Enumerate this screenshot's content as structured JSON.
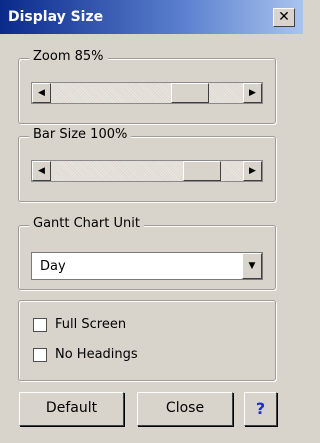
{
  "window": {
    "title": "Display Size",
    "close_glyph": "✕",
    "close_icon": "close-icon"
  },
  "zoom": {
    "label": "Zoom 85%",
    "value_percent": 85,
    "thumb_position": 0.78
  },
  "bar_size": {
    "label": "Bar Size 100%",
    "value_percent": 100,
    "thumb_position": 0.86
  },
  "gantt": {
    "label": "Gantt Chart Unit",
    "selected": "Day"
  },
  "options": {
    "full_screen": {
      "label": "Full Screen",
      "checked": false
    },
    "no_headings": {
      "label": "No Headings",
      "checked": false
    }
  },
  "buttons": {
    "default_label": "Default",
    "close_label": "Close",
    "help_label": "?"
  },
  "colors": {
    "background": "#d8d4cb",
    "title_start": "#0a2a8a",
    "title_end": "#a9c4ee",
    "help": "#1a32c8"
  }
}
